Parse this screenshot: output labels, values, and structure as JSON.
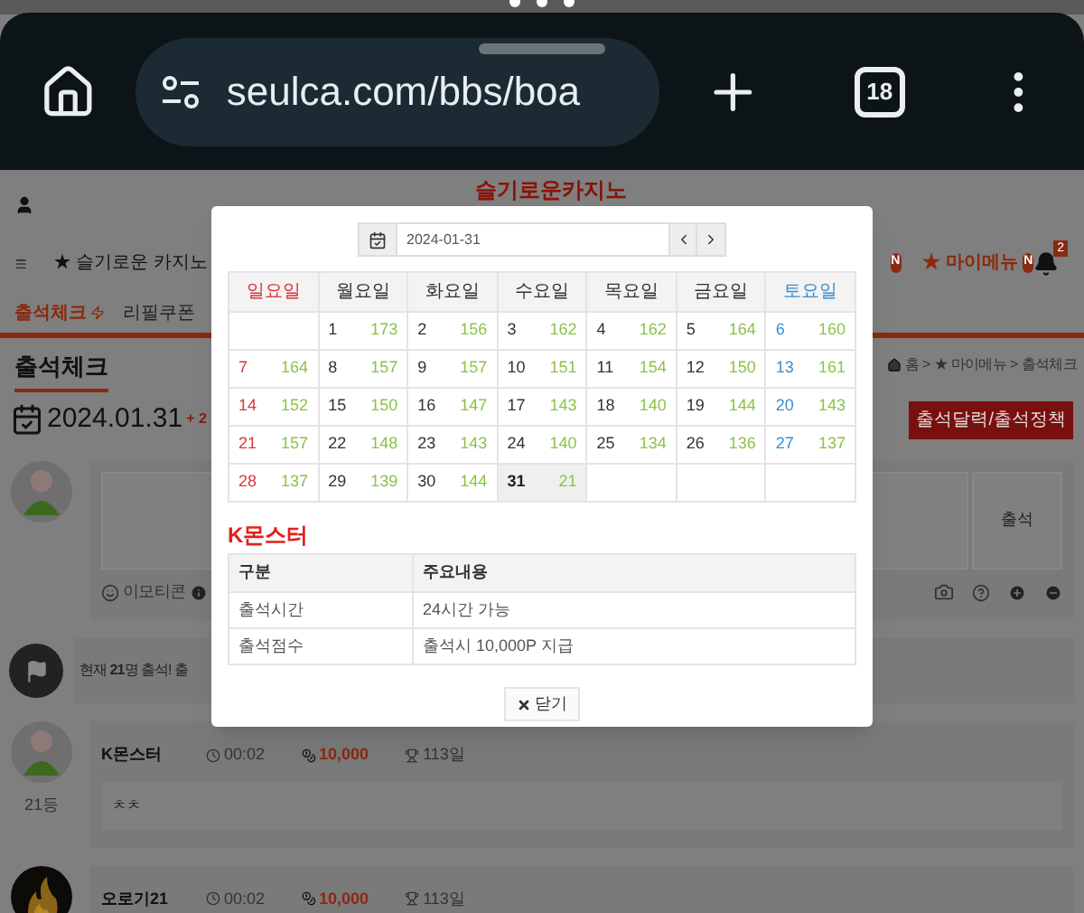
{
  "browser": {
    "url": "seulca.com/bbs/boa",
    "tab_count": "18"
  },
  "site": {
    "logo": "슬기로운카지노"
  },
  "nav": {
    "home_link": "★ 슬기로운 카지노",
    "hidden_badge": "N",
    "my_menu": {
      "label": "★ 마이메뉴",
      "badge": "N"
    },
    "notification_count": "2"
  },
  "tabs": [
    {
      "label": "출석체크",
      "selected": true
    },
    {
      "label": "리필쿠폰",
      "selected": false
    }
  ],
  "page": {
    "title": "출석체크",
    "breadcrumb": "홈 > ★ 마이메뉴 > 출석체크",
    "date": "2024.01.31",
    "date_extra": "+ 2",
    "calendar_button": "출석달력/출석정책"
  },
  "comment_form": {
    "submit": "출석",
    "emoticon": "이모티콘"
  },
  "notice": "현재 **21**명 출석! 출",
  "entries": [
    {
      "name": "K몬스터",
      "time": "00:02",
      "points": "10,000",
      "days": "113일",
      "rank": "21등",
      "message": "ㅊㅊ",
      "avatar": {
        "kind": "figure"
      }
    },
    {
      "name": "오로기21",
      "time": "00:02",
      "points": "10,000",
      "days": "113일"
    }
  ],
  "modal": {
    "date": "2024-01-31",
    "weekdays": [
      {
        "label": "일요일",
        "color": "#d9363e"
      },
      {
        "label": "월요일",
        "color": "#333333"
      },
      {
        "label": "화요일",
        "color": "#333333"
      },
      {
        "label": "수요일",
        "color": "#333333"
      },
      {
        "label": "목요일",
        "color": "#333333"
      },
      {
        "label": "금요일",
        "color": "#333333"
      },
      {
        "label": "토요일",
        "color": "#3a8fd0"
      }
    ],
    "weeks": [
      [
        {
          "kind": "blank"
        },
        {
          "day": "1",
          "count": "173",
          "selected": false
        },
        {
          "day": "2",
          "count": "156",
          "selected": false
        },
        {
          "day": "3",
          "count": "162",
          "selected": false
        },
        {
          "day": "4",
          "count": "162",
          "selected": false
        },
        {
          "day": "5",
          "count": "164",
          "selected": false
        },
        {
          "day": "6",
          "count": "160",
          "selected": false
        }
      ],
      [
        {
          "day": "7",
          "count": "164",
          "selected": false
        },
        {
          "day": "8",
          "count": "157",
          "selected": false
        },
        {
          "day": "9",
          "count": "157",
          "selected": false
        },
        {
          "day": "10",
          "count": "151",
          "selected": false
        },
        {
          "day": "11",
          "count": "154",
          "selected": false
        },
        {
          "day": "12",
          "count": "150",
          "selected": false
        },
        {
          "day": "13",
          "count": "161",
          "selected": false
        }
      ],
      [
        {
          "day": "14",
          "count": "152",
          "selected": false
        },
        {
          "day": "15",
          "count": "150",
          "selected": false
        },
        {
          "day": "16",
          "count": "147",
          "selected": false
        },
        {
          "day": "17",
          "count": "143",
          "selected": false
        },
        {
          "day": "18",
          "count": "140",
          "selected": false
        },
        {
          "day": "19",
          "count": "144",
          "selected": false
        },
        {
          "day": "20",
          "count": "143",
          "selected": false
        }
      ],
      [
        {
          "day": "21",
          "count": "157",
          "selected": false
        },
        {
          "day": "22",
          "count": "148",
          "selected": false
        },
        {
          "day": "23",
          "count": "143",
          "selected": false
        },
        {
          "day": "24",
          "count": "140",
          "selected": false
        },
        {
          "day": "25",
          "count": "134",
          "selected": false
        },
        {
          "day": "26",
          "count": "136",
          "selected": false
        },
        {
          "day": "27",
          "count": "137",
          "selected": false
        }
      ],
      [
        {
          "day": "28",
          "count": "137",
          "selected": false
        },
        {
          "day": "29",
          "count": "139",
          "selected": false
        },
        {
          "day": "30",
          "count": "144",
          "selected": false
        },
        {
          "day": "31",
          "count": "21",
          "selected": true
        },
        {
          "kind": "blank"
        },
        {
          "kind": "blank"
        },
        {
          "kind": "blank"
        }
      ]
    ],
    "info_title": "K몬스터",
    "info_table": {
      "columns": [
        "구분",
        "주요내용"
      ],
      "rows": [
        [
          "출석시간",
          "24시간 가능"
        ],
        [
          "출석점수",
          "출석시 10,000P 지급"
        ]
      ]
    },
    "close": "닫기"
  }
}
